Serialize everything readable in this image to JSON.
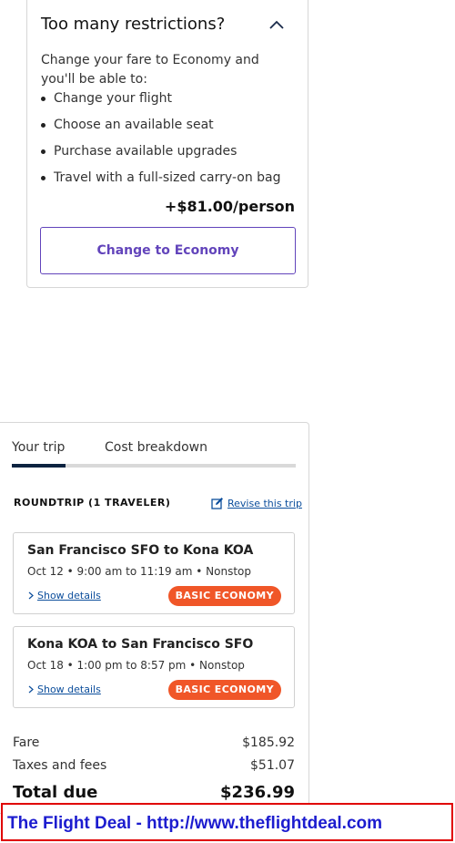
{
  "upsell": {
    "title": "Too many restrictions?",
    "description": "Change your fare to Economy and you'll be able to:",
    "benefits": [
      "Change your flight",
      "Choose an available seat",
      "Purchase available upgrades",
      "Travel with a full-sized carry-on bag"
    ],
    "price": "+$81.00/person",
    "button_label": "Change to Economy",
    "collapse_icon": "chevron-up-icon"
  },
  "trip": {
    "tabs": [
      {
        "label": "Your trip",
        "active": true
      },
      {
        "label": "Cost breakdown",
        "active": false
      }
    ],
    "heading": "ROUNDTRIP (1 TRAVELER)",
    "revise_label": "Revise this trip",
    "flights": [
      {
        "route": "San Francisco SFO to Kona KOA",
        "times": "Oct 12 • 9:00 am to 11:19 am • Nonstop",
        "details_label": "Show details",
        "badge": "BASIC ECONOMY"
      },
      {
        "route": "Kona KOA to San Francisco SFO",
        "times": "Oct 18 • 1:00 pm to 8:57 pm • Nonstop",
        "details_label": "Show details",
        "badge": "BASIC ECONOMY"
      }
    ],
    "costs": {
      "fare_label": "Fare",
      "fare_value": "$185.92",
      "taxes_label": "Taxes and fees",
      "taxes_value": "$51.07",
      "total_label": "Total due",
      "total_value": "$236.99"
    }
  },
  "watermark": {
    "text": "The Flight Deal - http://www.theflightdeal.com"
  },
  "colors": {
    "accent_purple": "#6244bb",
    "navy": "#0c2340",
    "link_blue": "#0c4e9c",
    "badge_orange": "#f05628",
    "watermark_blue": "#1c1ccf",
    "watermark_red": "#e00000"
  }
}
